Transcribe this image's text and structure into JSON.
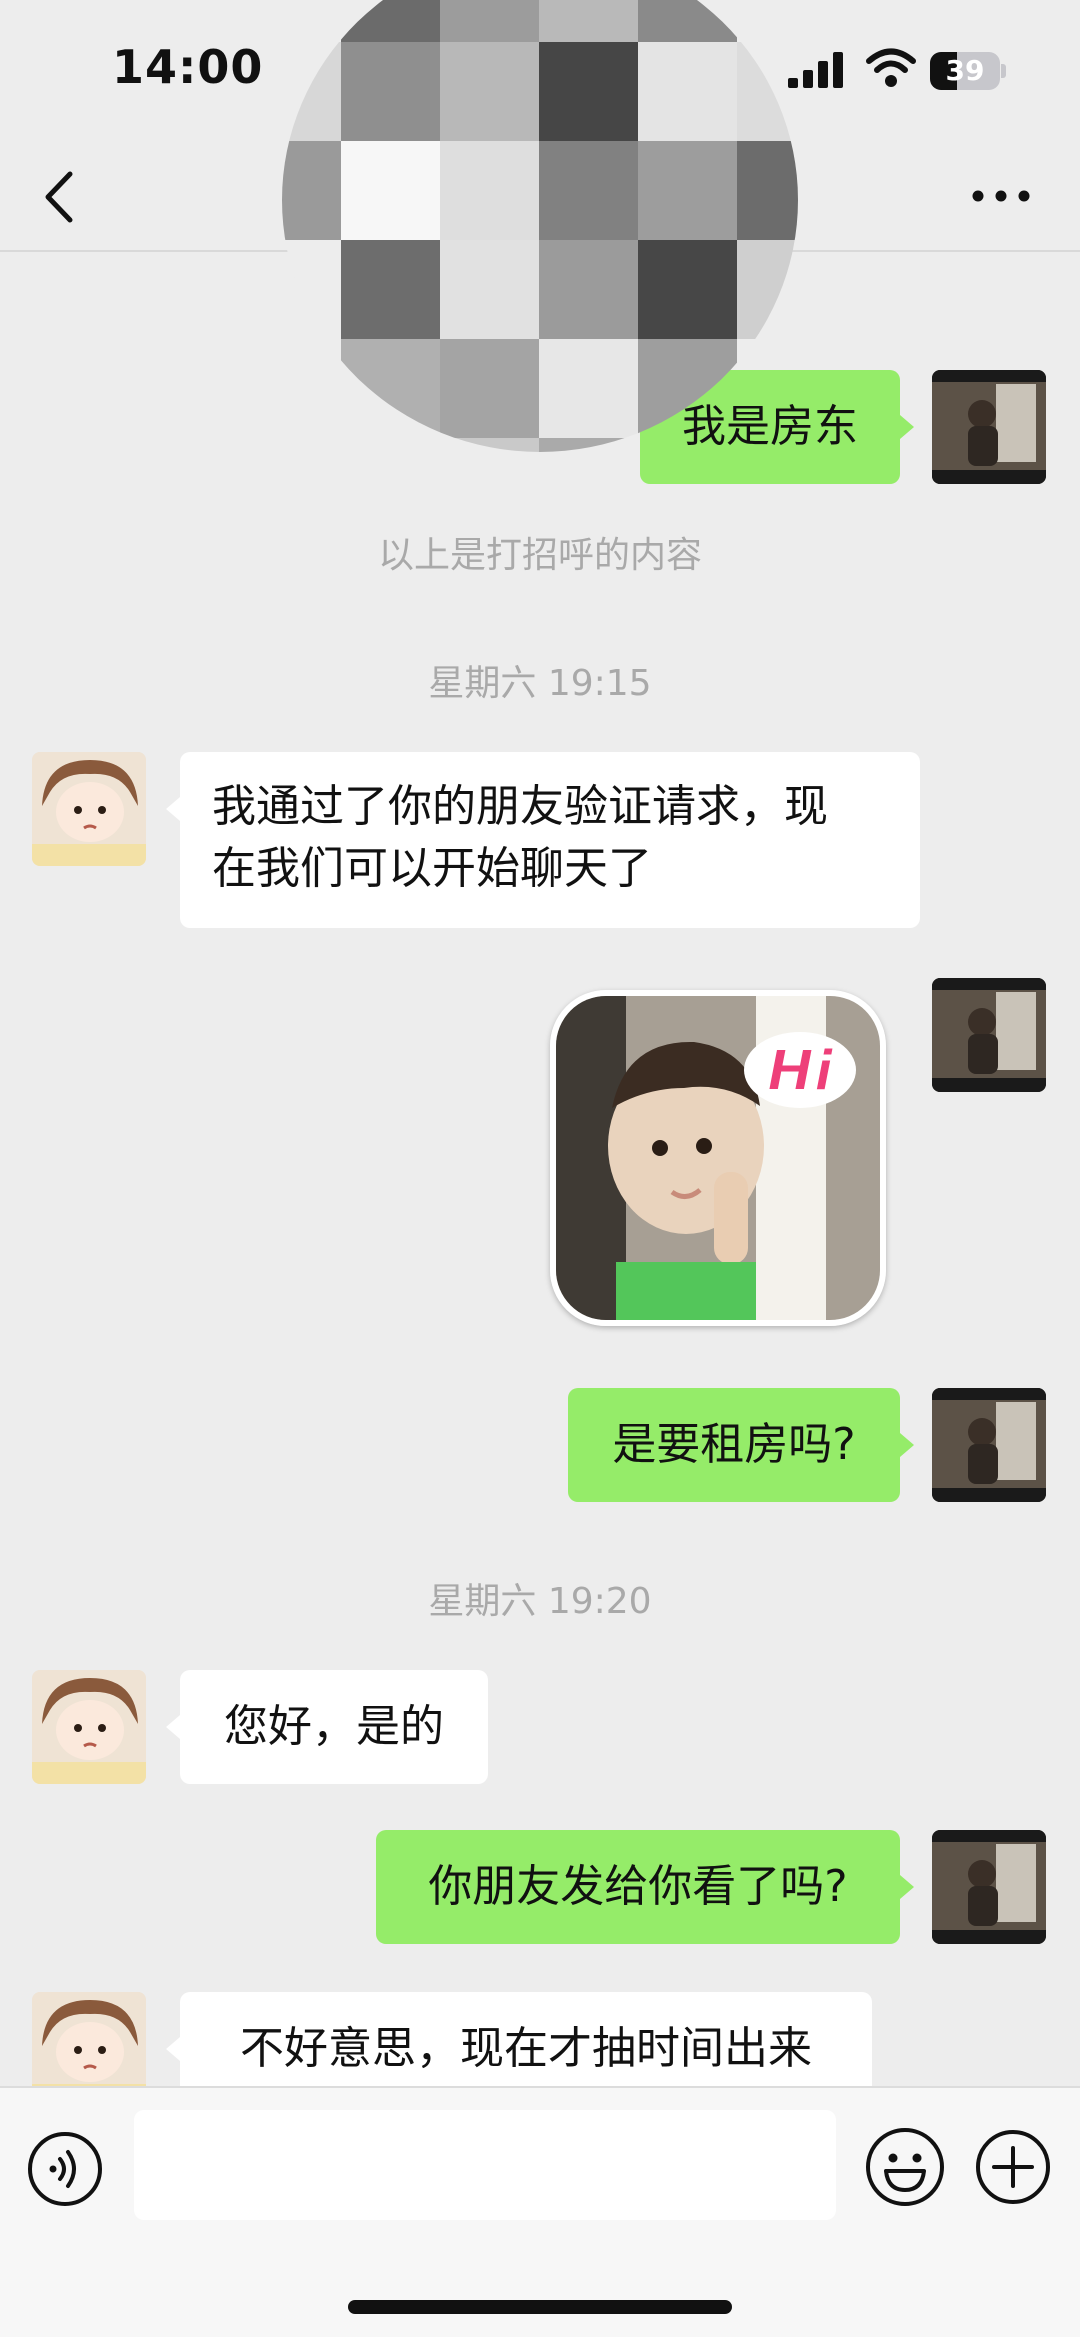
{
  "status_bar": {
    "time": "14:00",
    "battery_level": "39",
    "icons": [
      "signal-icon",
      "wifi-icon",
      "battery-icon"
    ]
  },
  "nav": {
    "icons": [
      "back-icon",
      "more-icon"
    ]
  },
  "messages": [
    {
      "side": "out",
      "type": "text",
      "text": "我是房东"
    },
    {
      "side": "system",
      "type": "note",
      "text": "以上是打招呼的内容"
    },
    {
      "side": "system",
      "type": "time",
      "text": "星期六 19:15"
    },
    {
      "side": "in",
      "type": "text",
      "lines": [
        "我通过了你的朋友验证请求，现",
        "在我们可以开始聊天了"
      ]
    },
    {
      "side": "out",
      "type": "sticker",
      "text": "Hi"
    },
    {
      "side": "out",
      "type": "text",
      "text": "是要租房吗?"
    },
    {
      "side": "system",
      "type": "time",
      "text": "星期六 19:20"
    },
    {
      "side": "in",
      "type": "text",
      "text": "您好，是的"
    },
    {
      "side": "out",
      "type": "text",
      "text": "你朋友发给你看了吗?"
    },
    {
      "side": "in",
      "type": "text",
      "text": "不好意思，现在才抽时间出来"
    }
  ],
  "input_bar": {
    "value": "",
    "icons": [
      "voice-icon",
      "emoji-icon",
      "plus-icon"
    ]
  },
  "colors": {
    "outgoing_bubble": "#95ec69",
    "incoming_bubble": "#ffffff",
    "background": "#ededed",
    "system_text": "#a9a9a9"
  }
}
